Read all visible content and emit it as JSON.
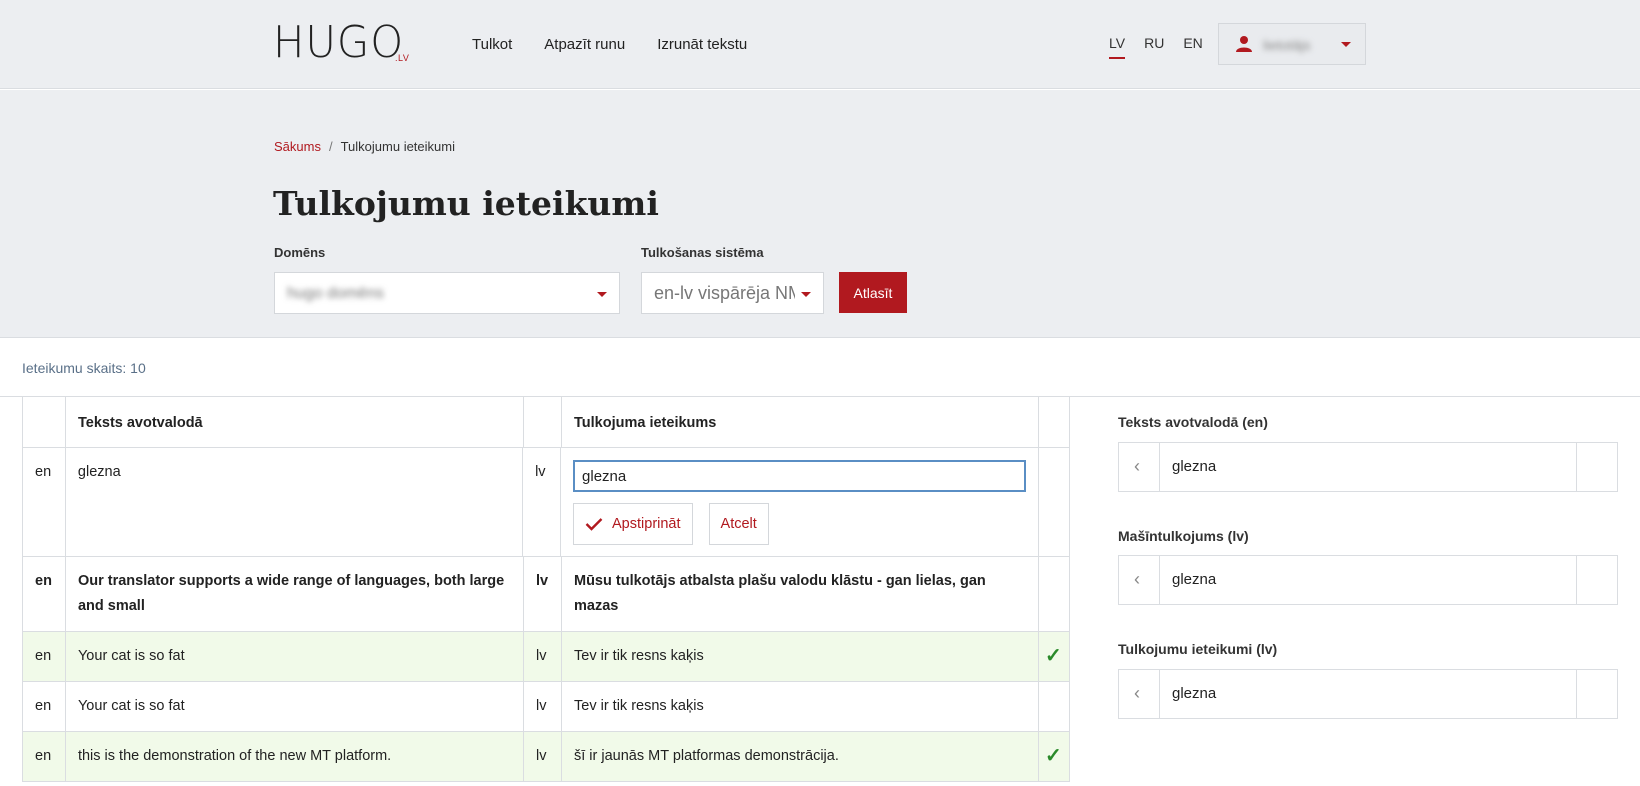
{
  "header": {
    "logo_main": "HUGO",
    "logo_sub": ".LV",
    "nav": [
      "Tulkot",
      "Atpazīt runu",
      "Izrunāt tekstu"
    ],
    "langs": [
      "LV",
      "RU",
      "EN"
    ],
    "active_lang": "LV",
    "user_name": "lietotājs"
  },
  "breadcrumb": {
    "home": "Sākums",
    "separator": "/",
    "current": "Tulkojumu ieteikumi"
  },
  "page_title": "Tulkojumu ieteikumi",
  "filters": {
    "domain_label": "Domēns",
    "domain_value": "hugo domēns",
    "system_label": "Tulkošanas sistēma",
    "system_value": "en-lv vispārēja NMT",
    "submit_label": "Atlasīt"
  },
  "count_text": "Ieteikumu skaits: 10",
  "table": {
    "headers": {
      "source": "Teksts avotvalodā",
      "suggestion": "Tulkojuma ieteikums"
    },
    "edit_row": {
      "src_lang": "en",
      "source": "glezna",
      "tgt_lang": "lv",
      "input_value": "glezna",
      "approve_label": "Apstiprināt",
      "cancel_label": "Atcelt"
    },
    "rows": [
      {
        "src_lang": "en",
        "source": "Our translator supports a wide range of languages, both large and small",
        "tgt_lang": "lv",
        "target": "Mūsu tulkotājs atbalsta plašu valodu klāstu - gan lielas, gan mazas",
        "approved": false,
        "bold": true
      },
      {
        "src_lang": "en",
        "source": "Your cat is so fat",
        "tgt_lang": "lv",
        "target": "Tev ir tik resns kaķis",
        "approved": true,
        "bold": false
      },
      {
        "src_lang": "en",
        "source": "Your cat is so fat",
        "tgt_lang": "lv",
        "target": "Tev ir tik resns kaķis",
        "approved": false,
        "bold": false
      },
      {
        "src_lang": "en",
        "source": "this is the demonstration of the new MT platform.",
        "tgt_lang": "lv",
        "target": "šī ir jaunās MT platformas demonstrācija.",
        "approved": true,
        "bold": false
      }
    ],
    "check_symbol": "✓"
  },
  "side": {
    "source_label": "Teksts avotvalodā (en)",
    "source_value": "glezna",
    "mt_label": "Mašīntulkojums (lv)",
    "mt_value": "glezna",
    "suggest_label": "Tulkojumu ieteikumi (lv)",
    "suggest_value": "glezna",
    "prev_symbol": "‹"
  },
  "colors": {
    "accent": "#b1191f",
    "approved_bg": "#f1fae9",
    "check": "#2a8a2a",
    "header_bg": "#eceef1"
  }
}
